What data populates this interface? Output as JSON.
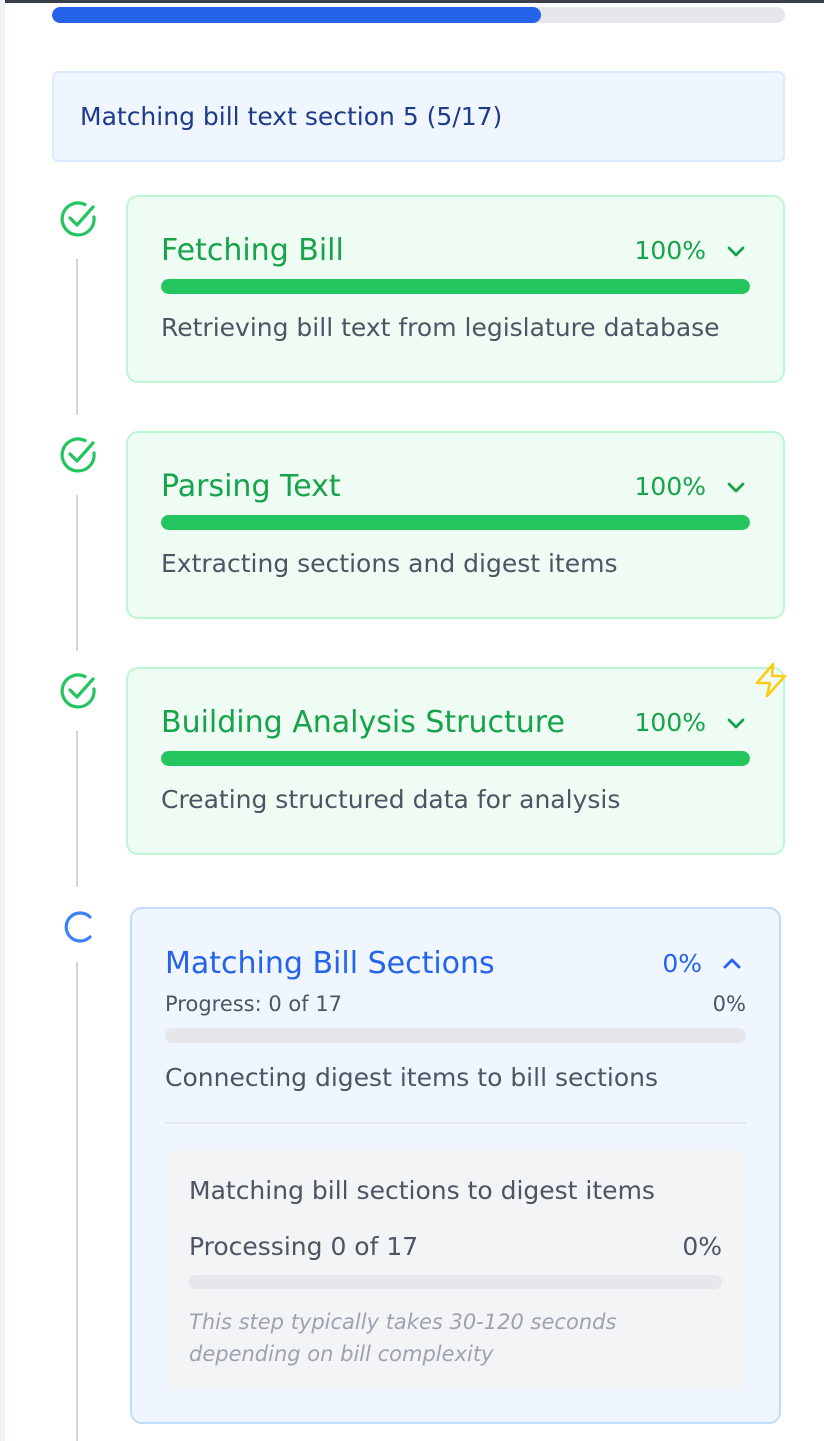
{
  "overall_progress": {
    "fraction": 0.667,
    "fill_color": "#2563eb"
  },
  "status_banner": {
    "text": "Matching bill text section 5 (5/17)"
  },
  "steps": [
    {
      "title": "Fetching Bill",
      "percent_label": "100%",
      "progress": 1.0,
      "description": "Retrieving bill text from legislature database",
      "status": "complete",
      "icon": "check-circle-icon",
      "expand_icon": "chevron-down-icon"
    },
    {
      "title": "Parsing Text",
      "percent_label": "100%",
      "progress": 1.0,
      "description": "Extracting sections and digest items",
      "status": "complete",
      "icon": "check-circle-icon",
      "expand_icon": "chevron-down-icon"
    },
    {
      "title": "Building Analysis Structure",
      "percent_label": "100%",
      "progress": 1.0,
      "description": "Creating structured data for analysis",
      "status": "complete",
      "icon": "check-circle-icon",
      "expand_icon": "chevron-down-icon",
      "badge_icon": "lightning-bolt-icon"
    },
    {
      "title": "Matching Bill Sections",
      "percent_label": "0%",
      "progress": 0.0,
      "progress_text": "Progress: 0 of 17",
      "progress_percent": "0%",
      "description": "Connecting digest items to bill sections",
      "status": "in-progress",
      "icon": "loading-spinner-icon",
      "expand_icon": "chevron-up-icon",
      "detail": {
        "title": "Matching bill sections to digest items",
        "processing_text": "Processing 0 of 17",
        "processing_percent": "0%",
        "progress": 0.0,
        "note": "This step typically takes 30-120 seconds depending on bill complexity"
      }
    }
  ],
  "colors": {
    "complete": "#16a34a",
    "complete_bar": "#22c55e",
    "active": "#2563eb",
    "lightning": "#facc15"
  }
}
